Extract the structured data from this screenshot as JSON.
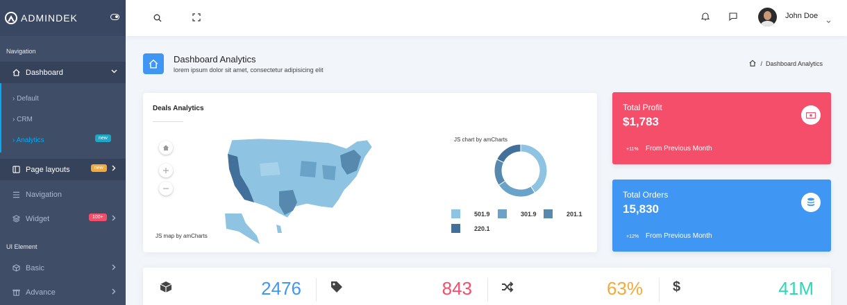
{
  "brand": {
    "name": "ADMINDEK"
  },
  "sidebar": {
    "caption_navigation": "Navigation",
    "caption_ui": "UI Element",
    "dashboard": {
      "label": "Dashboard"
    },
    "sub_items": [
      "Default",
      "CRM",
      "Analytics"
    ],
    "analytics_badge": "new",
    "page_layouts": {
      "label": "Page layouts",
      "badge": "new"
    },
    "navigation": {
      "label": "Navigation"
    },
    "widget": {
      "label": "Widget",
      "badge": "100+"
    },
    "basic": {
      "label": "Basic"
    },
    "advance": {
      "label": "Advance"
    }
  },
  "topbar": {
    "user_name": "John Doe"
  },
  "page_header": {
    "title": "Dashboard Analytics",
    "subtitle": "lorem ipsum dolor sit amet, consectetur adipisicing elit",
    "breadcrumb": "Dashboard Analytics"
  },
  "deals": {
    "title": "Deals Analytics",
    "map_credit": "JS map by amCharts",
    "chart_credit": "JS chart by amCharts"
  },
  "chart_data": {
    "type": "pie",
    "categories": [
      "",
      "",
      "",
      ""
    ],
    "values": [
      501.9,
      301.9,
      201.1,
      220.1
    ],
    "value_labels": [
      "501.9",
      "301.9",
      "201.1",
      "220.1"
    ],
    "colors": [
      "#8ec3e2",
      "#6aa3c7",
      "#5689ad",
      "#43709a"
    ]
  },
  "profit": {
    "title": "Total Profit",
    "value": "$1,783",
    "pct": "+11%",
    "foot": "From Previous Month",
    "color": "#f44e6b"
  },
  "orders": {
    "title": "Total Orders",
    "value": "15,830",
    "pct": "+12%",
    "foot": "From Previous Month",
    "color": "#3f97f3"
  },
  "bottom_stats": [
    {
      "icon": "cube-icon",
      "value": "2476",
      "color": "#3f97f3"
    },
    {
      "icon": "tag-icon",
      "value": "843",
      "color": "#f44e6b"
    },
    {
      "icon": "shuffle-icon",
      "value": "63%",
      "color": "#f4a93b"
    },
    {
      "icon": "dollar-icon",
      "value": "41M",
      "color": "#2ed8b6"
    }
  ]
}
